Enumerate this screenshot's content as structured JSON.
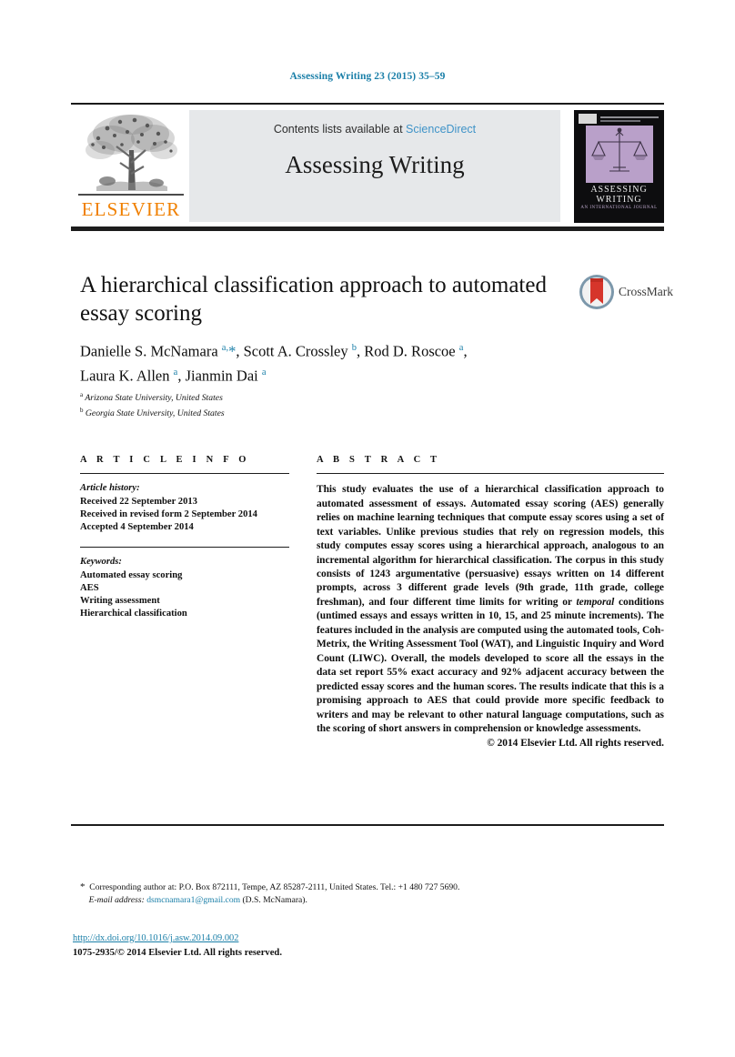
{
  "running_head": "Assessing Writing 23 (2015) 35–59",
  "masthead": {
    "contents_prefix": "Contents lists available at ",
    "sciencedirect": "ScienceDirect",
    "journal_name": "Assessing Writing",
    "publisher": "ELSEVIER",
    "cover": {
      "title_line1": "ASSESSING",
      "title_line2": "WRITING",
      "subtitle": "AN INTERNATIONAL JOURNAL"
    }
  },
  "article": {
    "title": "A hierarchical classification approach to automated essay scoring",
    "crossmark_label": "CrossMark",
    "authors_html": "Danielle S. McNamara <sup>a,</sup><span class=\"star\">*</span>, Scott A. Crossley <sup>b</sup>, Rod D. Roscoe <sup>a</sup>,<br>Laura K. Allen <sup>a</sup>, Jianmin Dai <sup>a</sup>",
    "affiliations": [
      {
        "marker": "a",
        "text": "Arizona State University, United States"
      },
      {
        "marker": "b",
        "text": "Georgia State University, United States"
      }
    ]
  },
  "article_info": {
    "heading": "A R T I C L E   I N F O",
    "history_label": "Article history:",
    "history": [
      "Received 22 September 2013",
      "Received in revised form 2 September 2014",
      "Accepted 4 September 2014"
    ],
    "keywords_label": "Keywords:",
    "keywords": [
      "Automated essay scoring",
      "AES",
      "Writing assessment",
      "Hierarchical classification"
    ]
  },
  "abstract": {
    "heading": "A B S T R A C T",
    "body_html": "This study evaluates the use of a hierarchical classification approach to automated assessment of essays. Automated essay scoring (AES) generally relies on machine learning techniques that compute essay scores using a set of text variables. Unlike previous studies that rely on regression models, this study computes essay scores using a hierarchical approach, analogous to an incremental algorithm for hierarchical classification. The corpus in this study consists of 1243 argumentative (persuasive) essays written on 14 different prompts, across 3 different grade levels (9th grade, 11th grade, college freshman), and four different time limits for writing or <span class=\"it\">temporal</span> conditions (untimed essays and essays written in 10, 15, and 25 minute increments). The features included in the analysis are computed using the automated tools, Coh-Metrix, the Writing Assessment Tool (WAT), and Linguistic Inquiry and Word Count (LIWC). Overall, the models developed to score all the essays in the data set report 55% exact accuracy and 92% adjacent accuracy between the predicted essay scores and the human scores. The results indicate that this is a promising approach to AES that could provide more specific feedback to writers and may be relevant to other natural language computations, such as the scoring of short answers in comprehension or knowledge assessments.",
    "copyright": "© 2014 Elsevier Ltd. All rights reserved."
  },
  "footer": {
    "corresponding_html": "<span class=\"star\">*</span>&nbsp; Corresponding author at: P.O. Box 872111, Tempe, AZ 85287-2111, United States. Tel.: +1 480 727 5690.<br>&nbsp;&nbsp;&nbsp;&nbsp;<span class=\"it\">E-mail address:</span> <span class=\"mail\">dsmcnamara1@gmail.com</span> (D.S. McNamara).",
    "doi": "http://dx.doi.org/10.1016/j.asw.2014.09.002",
    "issn_line": "1075-2935/© 2014 Elsevier Ltd. All rights reserved."
  },
  "colors": {
    "link_blue": "#1a7fa8",
    "sciencedirect_blue": "#3f93c8",
    "elsevier_orange": "#f08000",
    "cover_purple": "#b9a0c9",
    "rule_black": "#1d1d1d"
  }
}
